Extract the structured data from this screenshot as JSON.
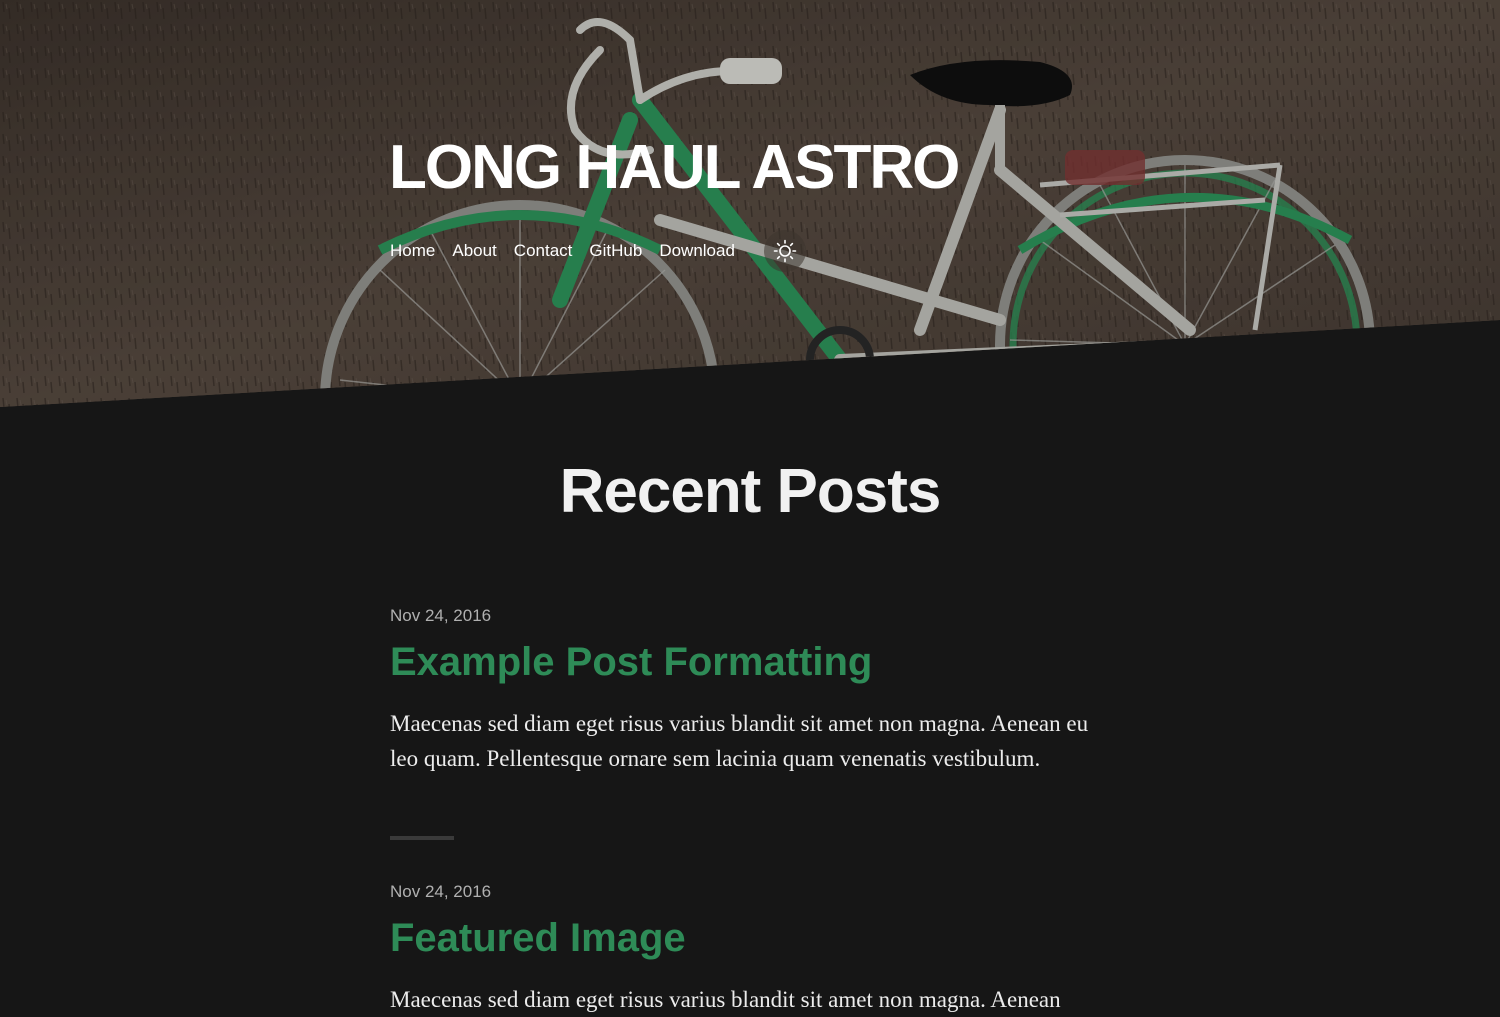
{
  "site": {
    "title": "LONG HAUL ASTRO"
  },
  "nav": {
    "items": [
      {
        "label": "Home"
      },
      {
        "label": "About"
      },
      {
        "label": "Contact"
      },
      {
        "label": "GitHub"
      },
      {
        "label": "Download"
      }
    ],
    "theme_toggle_icon": "sun-icon"
  },
  "main": {
    "heading": "Recent Posts",
    "posts": [
      {
        "date": "Nov 24, 2016",
        "title": "Example Post Formatting",
        "excerpt": "Maecenas sed diam eget risus varius blandit sit amet non magna. Aenean eu leo quam. Pellentesque ornare sem lacinia quam venenatis vestibulum."
      },
      {
        "date": "Nov 24, 2016",
        "title": "Featured Image",
        "excerpt": "Maecenas sed diam eget risus varius blandit sit amet non magna. Aenean"
      }
    ]
  },
  "colors": {
    "background": "#161616",
    "accent": "#2e8b57",
    "text": "#f2f2f2",
    "muted": "#b0b0b0"
  }
}
